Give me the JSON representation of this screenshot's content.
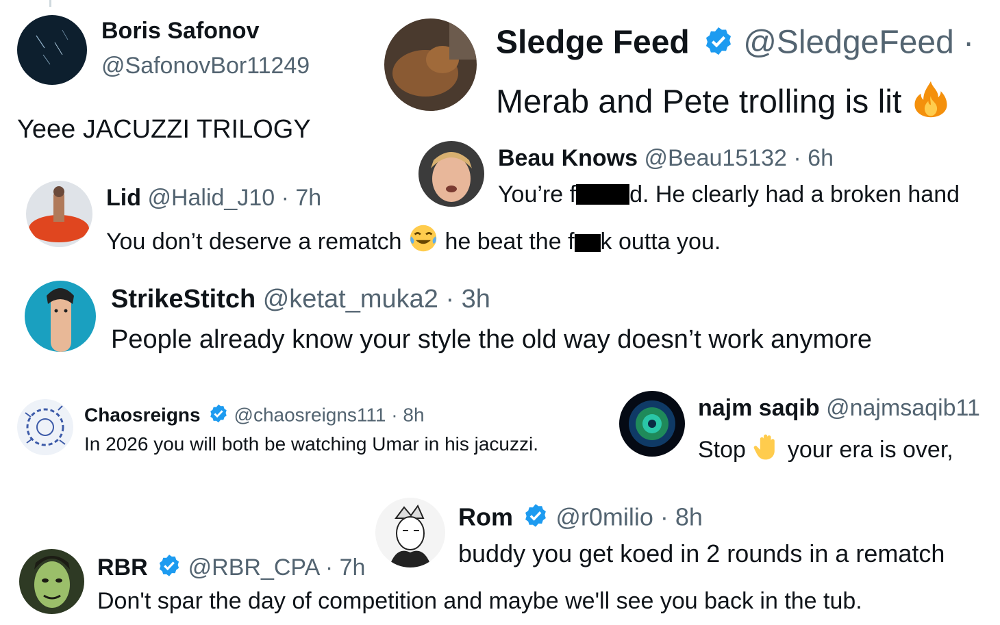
{
  "posts": {
    "boris": {
      "name": "Boris Safonov",
      "handle": "@SafonovBor11249",
      "text": "Yeee JACUZZI TRILOGY"
    },
    "sledge": {
      "name": "Sledge Feed",
      "handle": "@SledgeFeed",
      "separator": " ·",
      "text": "Merab and Pete trolling is lit",
      "emoji": "fire-emoji"
    },
    "beau": {
      "name": "Beau Knows",
      "handle": "@Beau15132",
      "meta": " · 6h",
      "text_before_redaction": "You’re f",
      "text_after_redaction": "d. He clearly had a broken hand"
    },
    "lid": {
      "name": "Lid",
      "handle": "@Halid_J10",
      "meta": " · 7h",
      "text_before_emoji": "You don’t deserve a rematch ",
      "text_after_emoji": " he beat the f",
      "text_end": "k outta you.",
      "emoji": "tears-of-joy-emoji"
    },
    "strike": {
      "name": "StrikeStitch",
      "handle": "@ketat_muka2",
      "meta": " · 3h",
      "text": "People already know your style the old way doesn’t work anymore"
    },
    "chaos": {
      "name": "Chaosreigns",
      "handle": "@chaosreigns111",
      "meta": " · 8h",
      "text": "In 2026 you will both be watching Umar in his jacuzzi."
    },
    "najm": {
      "name": "najm saqib",
      "handle": "@najmsaqib11",
      "text_before_emoji": "Stop ",
      "text_after_emoji": " your era is over,",
      "emoji": "raised-hand-emoji"
    },
    "rom": {
      "name": "Rom",
      "handle": "@r0milio",
      "meta": " · 8h",
      "text": "buddy you get koed in 2 rounds in a rematch"
    },
    "rbr": {
      "name": "RBR",
      "handle": "@RBR_CPA",
      "meta": " · 7h",
      "text": "Don't spar the day of competition and maybe we'll see you back in the tub."
    }
  },
  "colors": {
    "verified": "#1d9bf0",
    "handle": "#536471",
    "text": "#0f1419",
    "redaction": "#000000"
  }
}
